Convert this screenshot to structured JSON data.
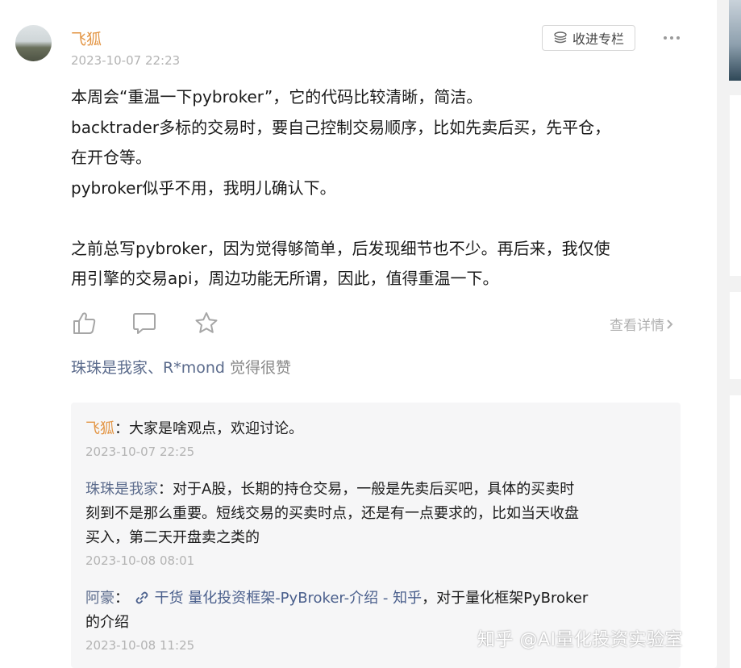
{
  "post": {
    "author": "飞狐",
    "time": "2023-10-07 22:23",
    "collect_label": "收进专栏",
    "body_lines": [
      "本周会“重温一下pybroker”，它的代码比较清晰，简洁。",
      "backtrader多标的交易时，要自己控制交易顺序，比如先卖后买，先平仓，",
      "在开仓等。",
      "pybroker似乎不用，我明儿确认下。",
      "",
      "之前总写pybroker，因为觉得够简单，后发现细节也不少。再后来，我仅使",
      "用引擎的交易api，周边功能无所谓，因此，值得重温一下。"
    ],
    "details_label": "查看详情",
    "likes": {
      "names": "珠珠是我家、R*mond",
      "suffix": " 觉得很赞"
    }
  },
  "comments": [
    {
      "name": "飞狐",
      "sep": "：",
      "lines": [
        "大家是啥观点，欢迎讨论。"
      ],
      "time": "2023-10-07 22:25"
    },
    {
      "name": "珠珠是我家",
      "sep": "：",
      "lines": [
        "对于A股，长期的持仓交易，一般是先卖后买吧，具体的买卖时",
        "刻到不是那么重要。短线交易的买卖时点，还是有一点要求的，比如当天收盘",
        "买入，第二天开盘卖之类的"
      ],
      "time": "2023-10-08 08:01"
    },
    {
      "name": "阿豪",
      "sep": "：",
      "link_text": "干货 量化投资框架-PyBroker-介绍 - 知乎",
      "after_link": "，对于量化框架PyBroker",
      "line2": "的介绍",
      "time": "2023-10-08 11:25"
    }
  ],
  "watermark": "知乎 @AI量化投资实验室",
  "icons": {
    "collect": "stack-icon",
    "more": "more-dots-icon",
    "like": "thumbs-up-icon",
    "comment": "comment-icon",
    "favorite": "star-icon",
    "chevron": "chevron-right-icon",
    "link": "link-icon"
  },
  "colors": {
    "author": "#e39544",
    "username": "#5b6b8c",
    "muted": "#b3b3b3",
    "text": "#1a1a1a"
  }
}
